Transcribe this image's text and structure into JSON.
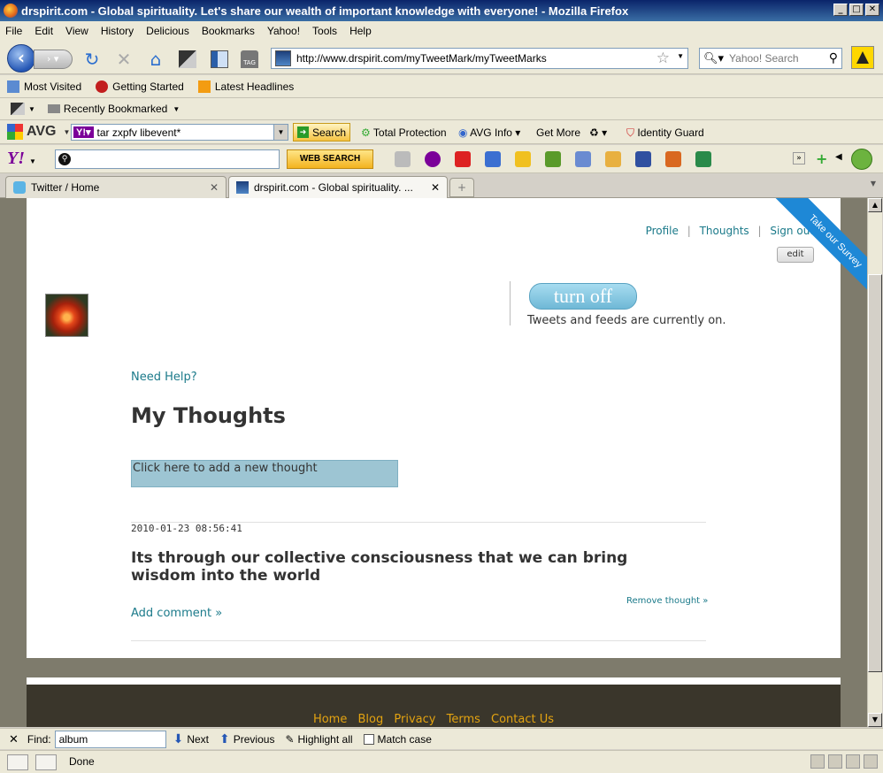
{
  "window": {
    "title": "drspirit.com - Global spirituality. Let's share our wealth of important knowledge with everyone! - Mozilla Firefox"
  },
  "menu": [
    "File",
    "Edit",
    "View",
    "History",
    "Delicious",
    "Bookmarks",
    "Yahoo!",
    "Tools",
    "Help"
  ],
  "nav": {
    "url": "http://www.drspirit.com/myTweetMark/myTweetMarks",
    "search_placeholder": "Yahoo! Search"
  },
  "bookmarks": {
    "items": [
      "Most Visited",
      "Getting Started",
      "Latest Headlines"
    ],
    "recently_bookmarked": "Recently Bookmarked"
  },
  "avg": {
    "logo": "AVG",
    "search_value": "tar zxpfv libevent*",
    "search_button": "Search",
    "total_protection": "Total Protection",
    "avg_info": "AVG Info",
    "get_more": "Get More",
    "identity_guard": "Identity Guard"
  },
  "yahoo": {
    "logo": "Y!",
    "button": "WEB SEARCH"
  },
  "tabs": [
    {
      "label": "Twitter / Home"
    },
    {
      "label": "drspirit.com - Global spirituality. ..."
    }
  ],
  "page": {
    "links": {
      "profile": "Profile",
      "thoughts": "Thoughts",
      "signout": "Sign out"
    },
    "edit": "edit",
    "survey": "Take our Survey",
    "turn_off": "turn off",
    "tweet_status": "Tweets and feeds are currently on.",
    "need_help": "Need Help?",
    "heading": "My Thoughts",
    "add_thought": "Click here to add a new thought",
    "entry": {
      "timestamp": "2010-01-23 08:56:41",
      "text": "Its through our collective consciousness that we can bring wisdom into the world",
      "remove": "Remove thought »",
      "add_comment": "Add comment »"
    },
    "footer_links": [
      "Home",
      "Blog",
      "Privacy",
      "Terms",
      "Contact Us"
    ]
  },
  "find": {
    "label": "Find:",
    "value": "album",
    "next": "Next",
    "previous": "Previous",
    "highlight": "Highlight all",
    "match_case": "Match case"
  },
  "status": {
    "text": "Done"
  },
  "colors": {
    "link": "#1b7a8a",
    "footer_link": "#e3a311",
    "survey_banner": "#1e88d6",
    "turn_off_button": "#6fb8d6"
  }
}
